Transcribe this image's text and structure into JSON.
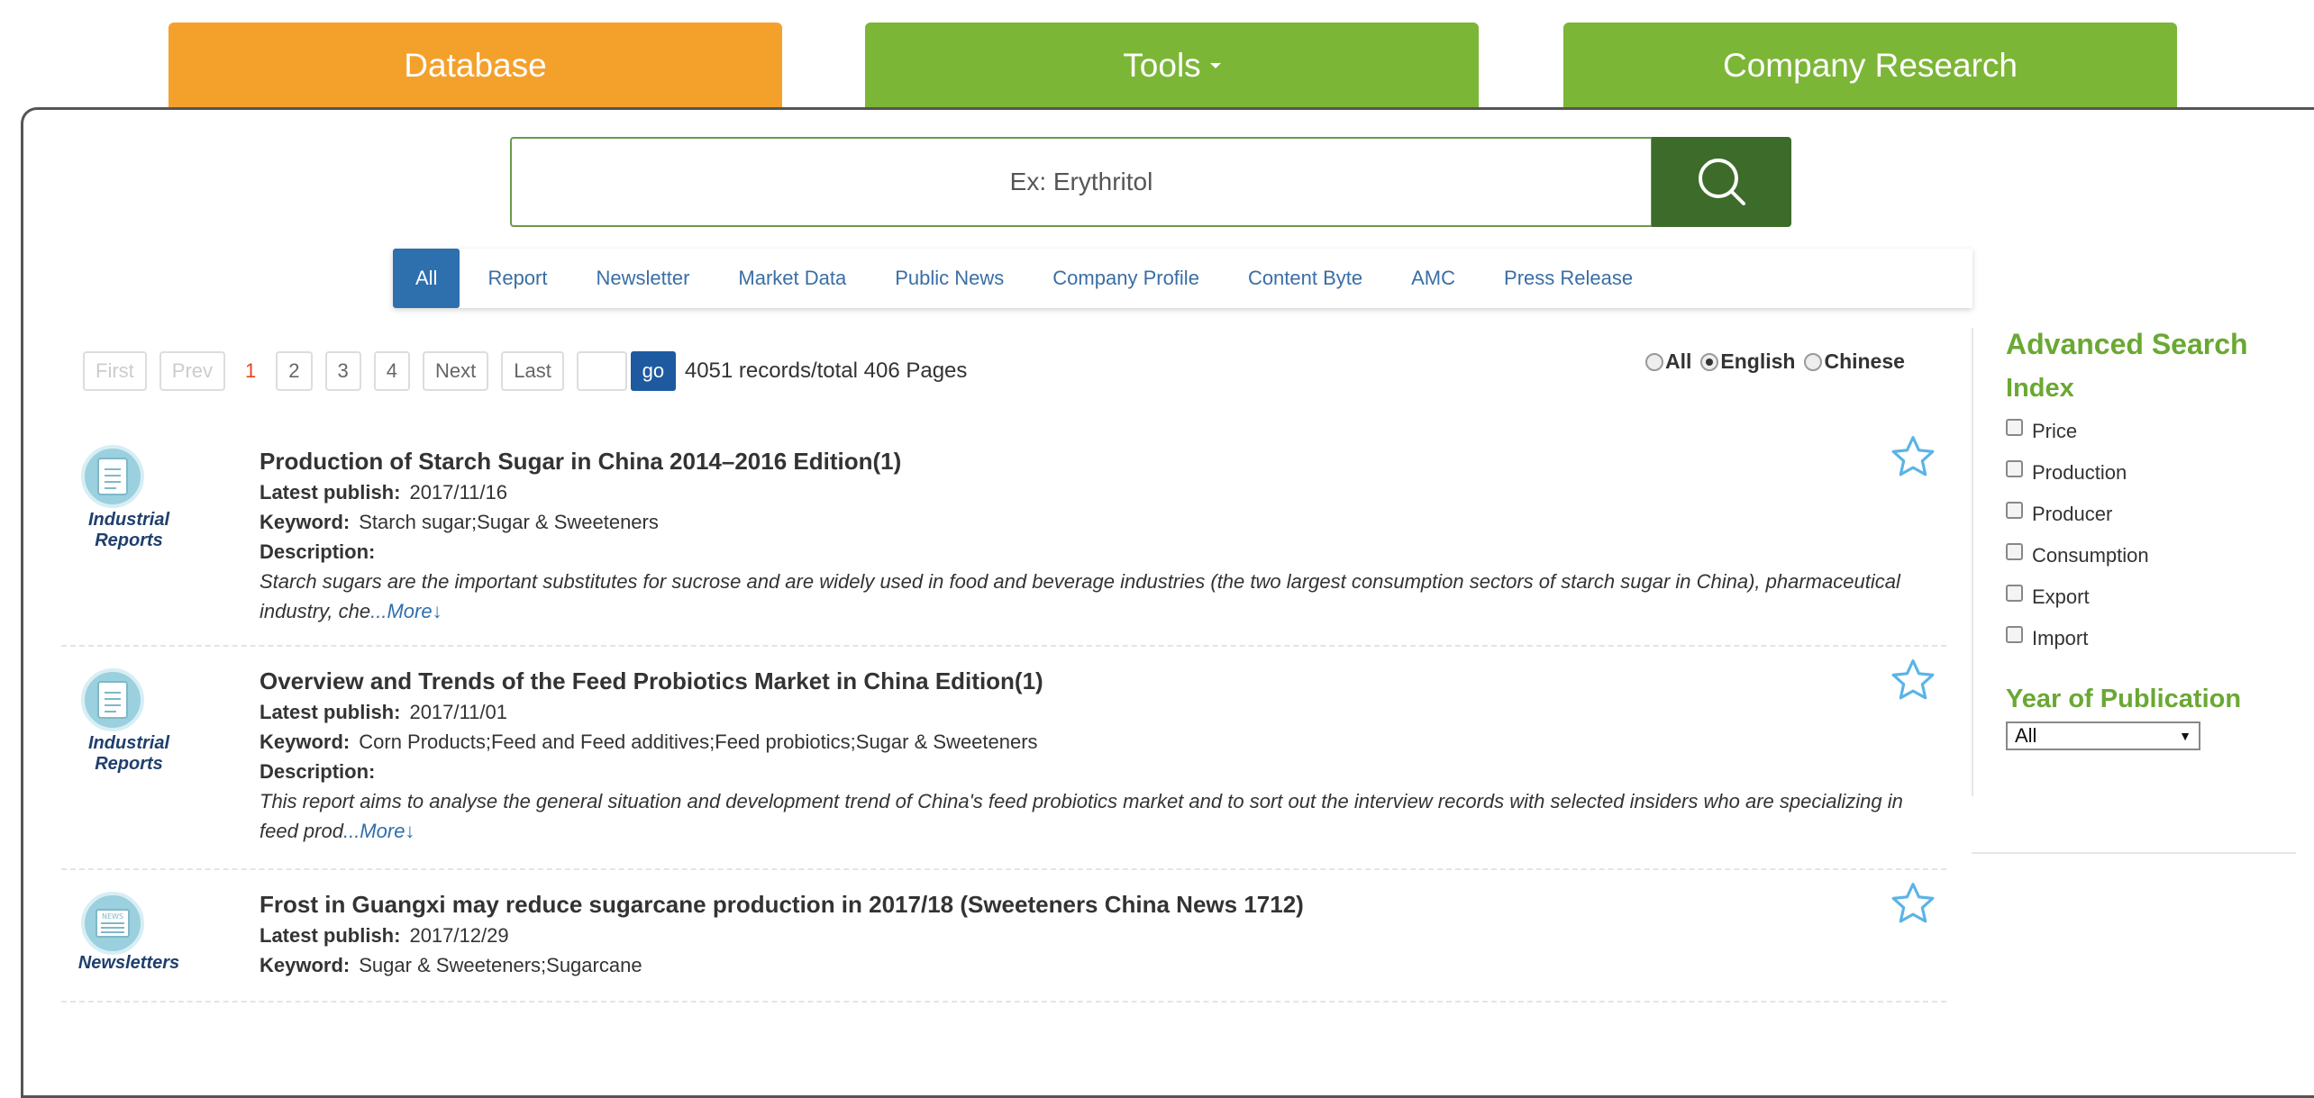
{
  "top_tabs": {
    "database": "Database",
    "tools": "Tools",
    "company": "Company Research"
  },
  "search": {
    "placeholder": "Ex: Erythritol"
  },
  "categories": [
    "All",
    "Report",
    "Newsletter",
    "Market Data",
    "Public News",
    "Company Profile",
    "Content Byte",
    "AMC",
    "Press Release"
  ],
  "pagination": {
    "first": "First",
    "prev": "Prev",
    "current": "1",
    "pages": [
      "2",
      "3",
      "4"
    ],
    "next": "Next",
    "last": "Last",
    "go": "go",
    "records": "4051 records/total 406 Pages"
  },
  "language": {
    "options": [
      "All",
      "English",
      "Chinese"
    ],
    "selected": "English"
  },
  "results": [
    {
      "type": [
        "Industrial",
        "Reports"
      ],
      "title": "Production of Starch Sugar in China 2014–2016 Edition(1)",
      "publish_label": "Latest publish:",
      "publish": "2017/11/16",
      "keyword_label": "Keyword:",
      "keyword": "Starch sugar;Sugar & Sweeteners",
      "desc_label": "Description:",
      "description": "Starch sugars are the important substitutes for sucrose and are widely used in food and beverage industries (the two largest consumption sectors of starch sugar in China), pharmaceutical industry, che",
      "more": "...More↓"
    },
    {
      "type": [
        "Industrial",
        "Reports"
      ],
      "title": "Overview and Trends of the Feed Probiotics Market in China Edition(1)",
      "publish_label": "Latest publish:",
      "publish": "2017/11/01",
      "keyword_label": "Keyword:",
      "keyword": "Corn Products;Feed and Feed additives;Feed probiotics;Sugar & Sweeteners",
      "desc_label": "Description:",
      "description": "This report aims to analyse the general situation and development trend of China's feed probiotics market and to sort out the interview records with selected insiders who are specializing in feed prod",
      "more": "...More↓"
    },
    {
      "type": [
        "Newsletters"
      ],
      "title": "Frost in Guangxi may reduce sugarcane production in 2017/18 (Sweeteners China News 1712)",
      "publish_label": "Latest publish:",
      "publish": "2017/12/29",
      "keyword_label": "Keyword:",
      "keyword": "Sugar & Sweeteners;Sugarcane"
    }
  ],
  "sidebar": {
    "title": "Advanced Search",
    "index_title": "Index",
    "index_items": [
      "Price",
      "Production",
      "Producer",
      "Consumption",
      "Export",
      "Import"
    ],
    "year_title": "Year of Publication",
    "year_value": "All"
  },
  "colors": {
    "orange": "#f4a12c",
    "green": "#7cb637",
    "dark_green": "#3d6b2a",
    "blue": "#2e6fae"
  }
}
